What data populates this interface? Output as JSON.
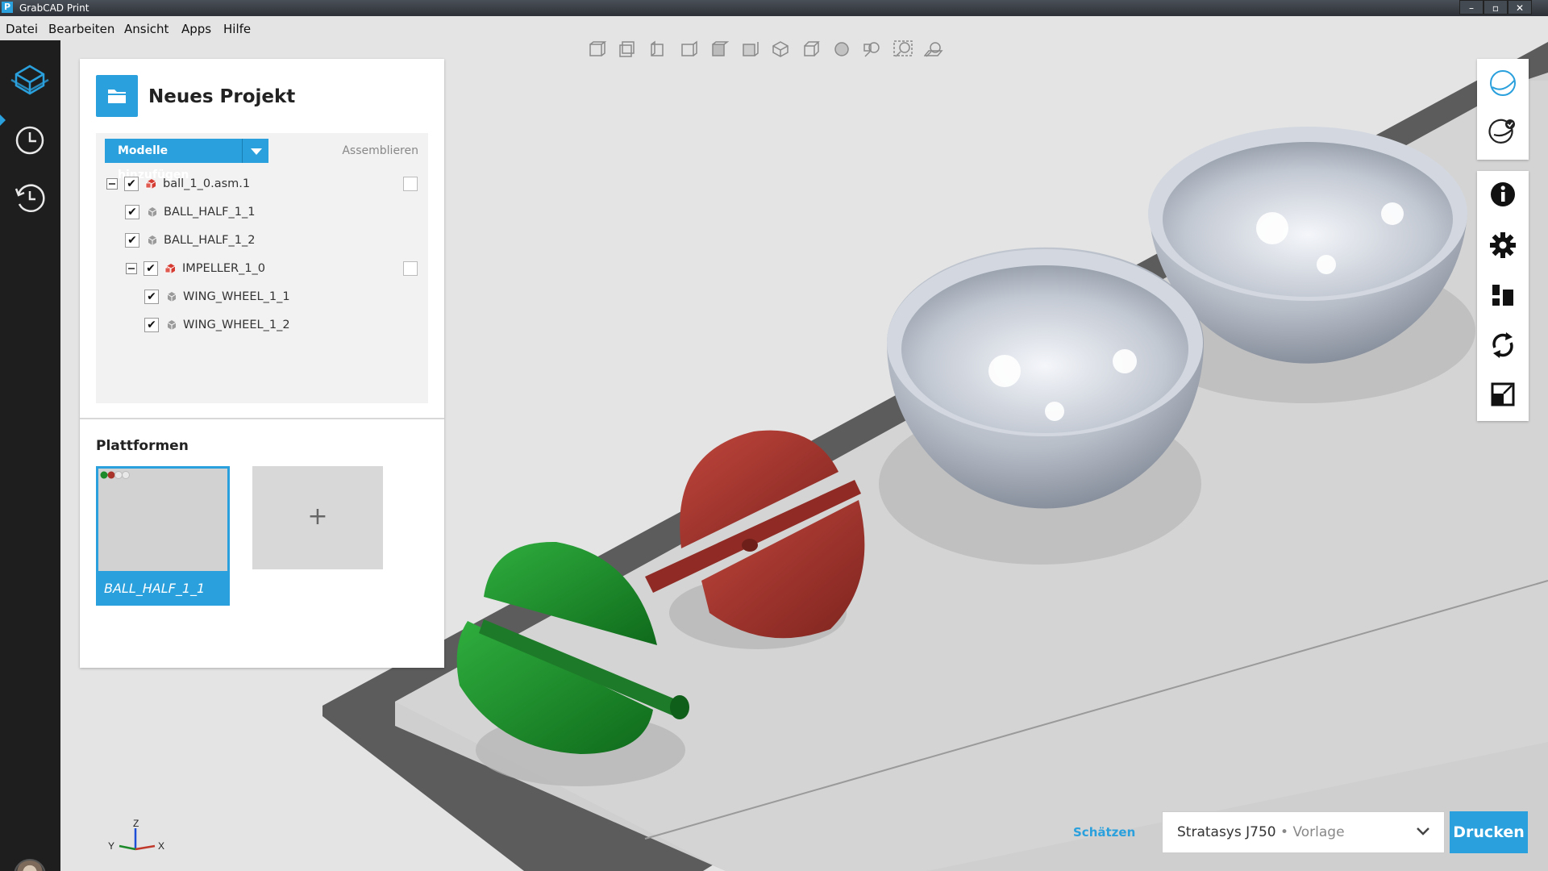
{
  "window": {
    "app_icon_letter": "P",
    "title": "GrabCAD Print",
    "controls": [
      "–",
      "▫",
      "✕"
    ]
  },
  "menu": [
    "Datei",
    "Bearbeiten",
    "Ansicht",
    "Apps",
    "Hilfe"
  ],
  "left_nav": {
    "items": [
      "models-cube-icon",
      "clock-icon",
      "history-icon"
    ],
    "active": "models-cube-icon"
  },
  "view_toolbar": {
    "icons": [
      "view-front-icon",
      "view-back-icon",
      "view-left-icon",
      "view-right-icon",
      "view-top-icon",
      "view-bottom-icon",
      "view-iso-icon",
      "view-perspective-icon",
      "shading-icon",
      "zoom-selection-icon",
      "zoom-all-icon",
      "zoom-platform-icon"
    ]
  },
  "project": {
    "title": "Neues Projekt",
    "add_models_label": "Modelle hinzufügen",
    "assemble_label": "Assemblieren",
    "tree": [
      {
        "label": "ball_1_0.asm.1",
        "type": "assembly",
        "checked": true,
        "expander": true
      },
      {
        "label": "BALL_HALF_1_1",
        "type": "part",
        "checked": true
      },
      {
        "label": "BALL_HALF_1_2",
        "type": "part",
        "checked": true
      },
      {
        "label": "IMPELLER_1_0",
        "type": "assembly",
        "checked": true,
        "expander": true
      },
      {
        "label": "WING_WHEEL_1_1",
        "type": "part",
        "checked": true
      },
      {
        "label": "WING_WHEEL_1_2",
        "type": "part",
        "checked": true
      }
    ],
    "platforms_heading": "Plattformen",
    "platform_name": "BALL_HALF_1_1",
    "add_platform_label": "+"
  },
  "right_toolbar": {
    "group1": [
      "orbit-icon",
      "check-model-icon"
    ],
    "group2": [
      "info-icon",
      "settings-icon",
      "arrange-icon",
      "rotate-icon",
      "scale-icon"
    ]
  },
  "bottom": {
    "estimate_label": "Schätzen",
    "printer_name": "Stratasys J750",
    "printer_separator": " • ",
    "printer_mode": "Vorlage",
    "print_label": "Drucken"
  },
  "axes": {
    "x": "X",
    "y": "Y",
    "z": "Z"
  },
  "colors": {
    "accent": "#2aa0dc",
    "green_part": "#1c8a2a",
    "red_part": "#a8342c",
    "gray_part": "#b8bec8"
  }
}
